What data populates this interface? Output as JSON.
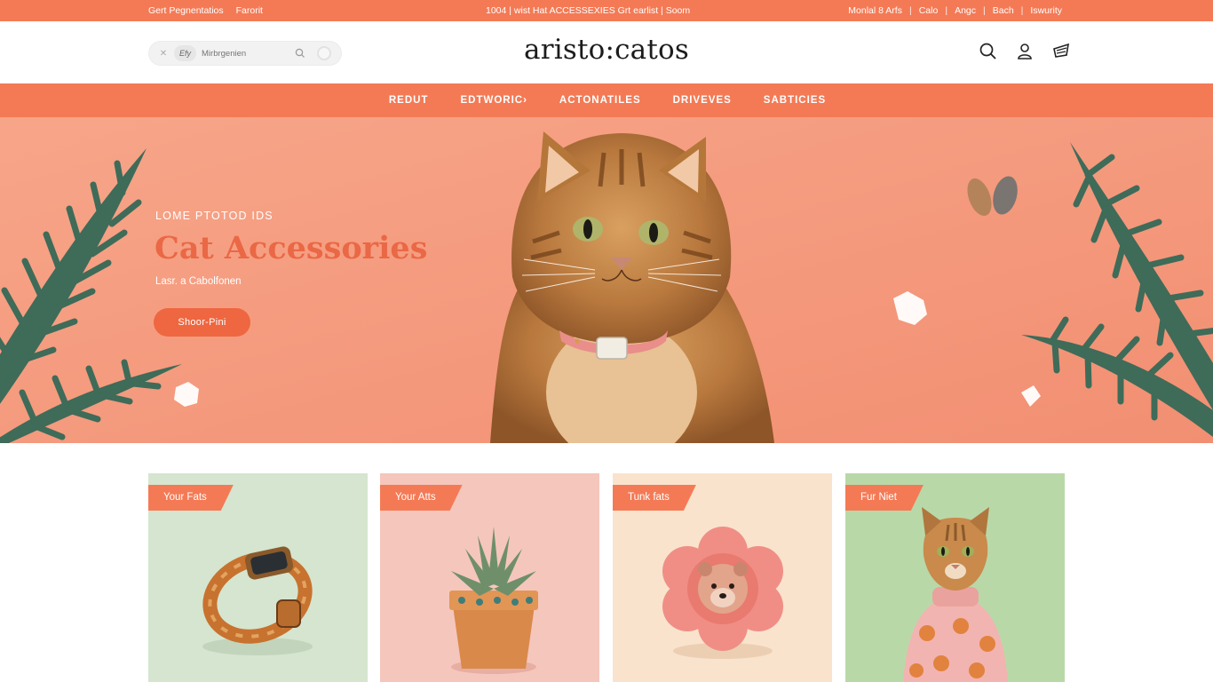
{
  "topbar": {
    "left_links": [
      "Gert Pegnentatios",
      "Farorit"
    ],
    "promo": "1004  |  wist Hat  ACCESSEXIES  Grt earlist  |  Soom",
    "right_links": [
      "Monlal 8  Arfs",
      "Calo",
      "Angc",
      "Bach",
      "Iswurity"
    ]
  },
  "header": {
    "logo": "aristo:catos",
    "search": {
      "chip": "Efy",
      "placeholder": "Mirbrgenien"
    },
    "icons": [
      "search-icon",
      "user-icon",
      "cart-icon"
    ]
  },
  "nav": {
    "items": [
      "REDUT",
      "EDTWORIC›",
      "ACTONATILES",
      "DRIVEVES",
      "SABTICIES"
    ]
  },
  "hero": {
    "eyebrow": "LOME PTOTOD IDS",
    "title": "Cat Accessories",
    "subtitle": "Lasr. a Cabolfonen",
    "cta": "Shoor-Pini"
  },
  "cards": [
    {
      "tag": "Your Fats",
      "bg": "#d5e5cf",
      "product": "cat-collar"
    },
    {
      "tag": "Your Atts",
      "bg": "#f5c6bc",
      "product": "succulent-pot"
    },
    {
      "tag": "Tunk fats",
      "bg": "#f9e3cc",
      "product": "flower-toy"
    },
    {
      "tag": "Fur Niet",
      "bg": "#b9d8a8",
      "product": "cat-sweater"
    }
  ],
  "colors": {
    "accent": "#f47a55",
    "hero_bg": "#f59a80",
    "title_color": "#ea6845"
  }
}
